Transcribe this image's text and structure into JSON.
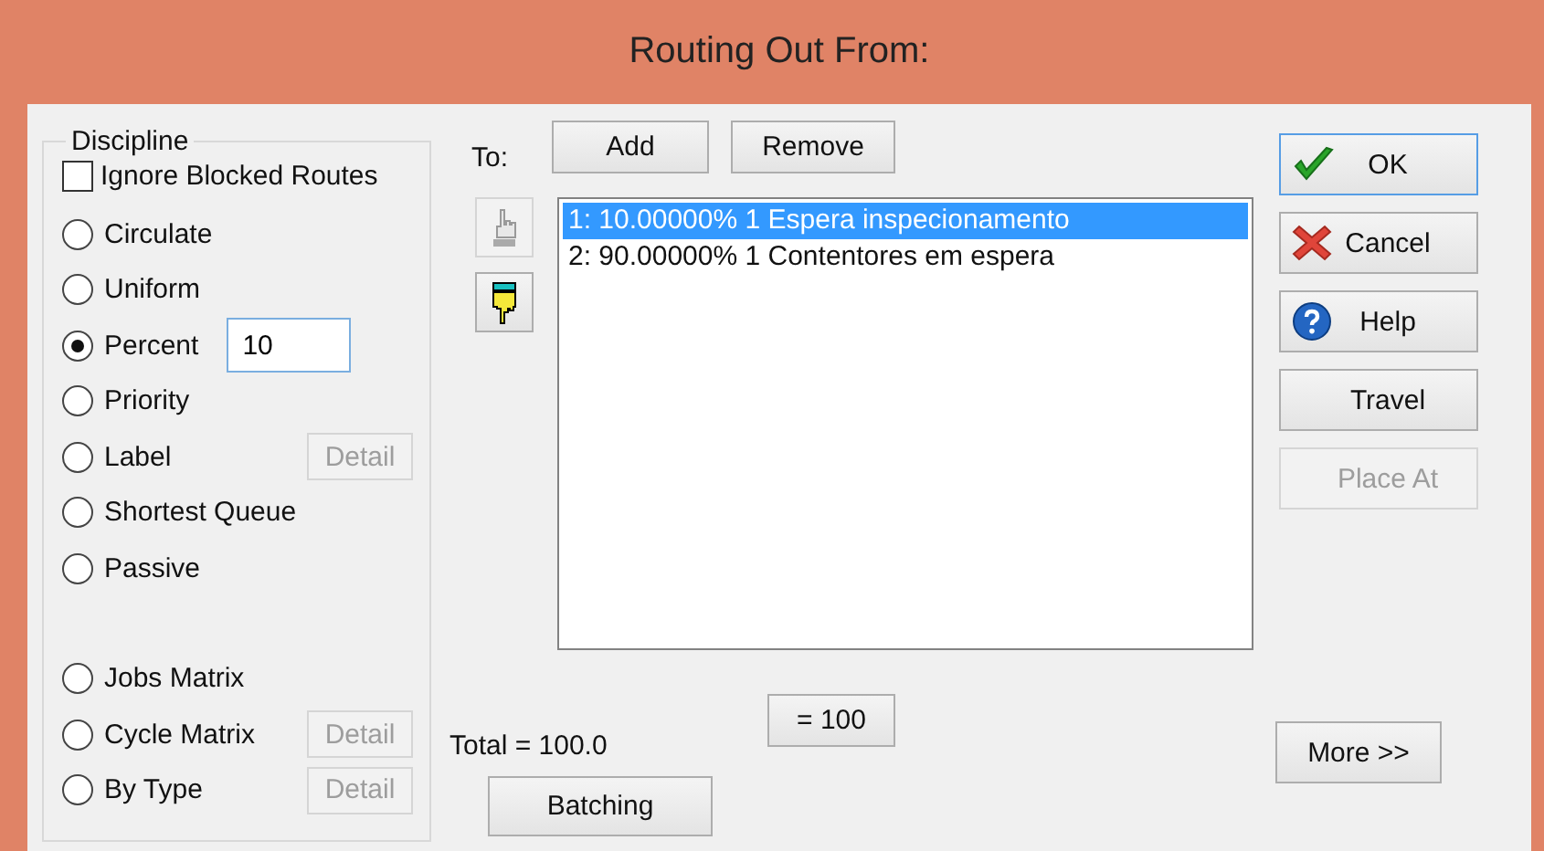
{
  "window": {
    "title": "Routing Out From:"
  },
  "discipline": {
    "title": "Discipline",
    "ignore_blocked": {
      "label": "Ignore Blocked Routes",
      "checked": false
    },
    "options": [
      {
        "label": "Circulate",
        "selected": false
      },
      {
        "label": "Uniform",
        "selected": false
      },
      {
        "label": "Percent",
        "selected": true,
        "value": "10"
      },
      {
        "label": "Priority",
        "selected": false
      },
      {
        "label": "Label",
        "selected": false,
        "detail": {
          "label": "Detail",
          "disabled": true
        }
      },
      {
        "label": "Shortest Queue",
        "selected": false
      },
      {
        "label": "Passive",
        "selected": false
      }
    ],
    "matrix_options": [
      {
        "label": "Jobs Matrix",
        "selected": false
      },
      {
        "label": "Cycle Matrix",
        "selected": false,
        "detail": {
          "label": "Detail",
          "disabled": true
        }
      },
      {
        "label": "By Type",
        "selected": false,
        "detail": {
          "label": "Detail",
          "disabled": true
        }
      }
    ]
  },
  "to": {
    "label": "To:",
    "buttons": [
      "Add",
      "Remove"
    ],
    "move_buttons": [
      {
        "kind": "up",
        "disabled": true
      },
      {
        "kind": "down",
        "disabled": false
      }
    ],
    "items": [
      {
        "text": "1:  10.00000% 1 Espera inspecionamento",
        "selected": true
      },
      {
        "text": "2:  90.00000% 1 Contentores em espera",
        "selected": false
      }
    ],
    "equals_button": "= 100",
    "total": "Total = 100.0",
    "batching_button": "Batching"
  },
  "actions": [
    {
      "label": "OK",
      "kind": "check",
      "disabled": false,
      "focused": true
    },
    {
      "label": "Cancel",
      "kind": "cross",
      "disabled": false,
      "focused": false
    },
    {
      "label": "Help",
      "kind": "help",
      "disabled": false,
      "focused": false
    },
    {
      "label": "Travel",
      "kind": "plain",
      "disabled": false,
      "focused": false
    },
    {
      "label": "Place At",
      "kind": "plain",
      "disabled": true,
      "focused": false
    }
  ],
  "more_button": "More >>"
}
